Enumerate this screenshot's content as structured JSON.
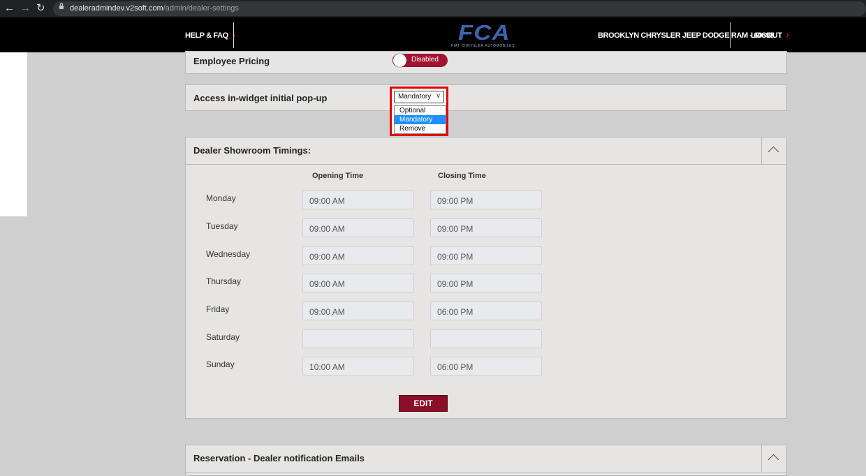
{
  "browser": {
    "url_host": "dealeradmindev.v2soft.com",
    "url_path": "/admin/dealer-settings"
  },
  "header": {
    "help_label": "HELP & FAQ",
    "logo_text": "FCA",
    "logo_sub": "FIAT CHRYSLER AUTOMOBILES",
    "dealer_name": "BROOKLYN CHRYSLER JEEP DODGE RAM - 60698",
    "logout_label": "LOGOUT"
  },
  "settings": {
    "employee_pricing": {
      "label": "Employee Pricing",
      "toggle_text": "Disabled",
      "enabled": false
    },
    "popup": {
      "label": "Access in-widget initial pop-up",
      "selected": "Mandatory",
      "options": [
        "Optional",
        "Mandatory",
        "Remove"
      ]
    }
  },
  "showroom": {
    "title": "Dealer Showroom Timings:",
    "col_open": "Opening Time",
    "col_close": "Closing Time",
    "rows": [
      {
        "day": "Monday",
        "open": "09:00 AM",
        "close": "09:00 PM"
      },
      {
        "day": "Tuesday",
        "open": "09:00 AM",
        "close": "09:00 PM"
      },
      {
        "day": "Wednesday",
        "open": "09:00 AM",
        "close": "09:00 PM"
      },
      {
        "day": "Thursday",
        "open": "09:00 AM",
        "close": "09:00 PM"
      },
      {
        "day": "Friday",
        "open": "09:00 AM",
        "close": "06:00 PM"
      },
      {
        "day": "Saturday",
        "open": "",
        "close": ""
      },
      {
        "day": "Sunday",
        "open": "10:00 AM",
        "close": "06:00 PM"
      }
    ],
    "edit_label": "EDIT"
  },
  "reservation": {
    "title": "Reservation - Dealer notification Emails"
  },
  "colors": {
    "brand_red": "#a11431",
    "logo_blue": "#3e64b0",
    "option_highlight": "#1e90ff",
    "callout": "#e50000"
  }
}
